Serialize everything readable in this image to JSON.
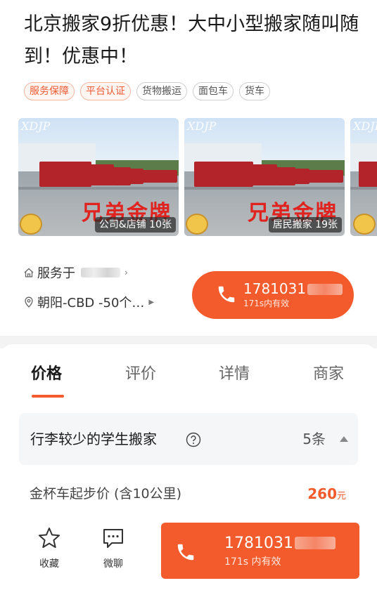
{
  "listing": {
    "title": "北京搬家9折优惠！大中小型搬家随叫随到！优惠中！"
  },
  "tags": [
    {
      "label": "服务保障",
      "highlight": true
    },
    {
      "label": "平台认证",
      "highlight": true
    },
    {
      "label": "货物搬运",
      "highlight": false
    },
    {
      "label": "面包车",
      "highlight": false
    },
    {
      "label": "货车",
      "highlight": false
    }
  ],
  "gallery": {
    "watermark": "XDJP",
    "slogan": "兄弟金牌",
    "photos": [
      {
        "caption": "公司&店铺 10张"
      },
      {
        "caption": "居民搬家 19张"
      }
    ]
  },
  "service": {
    "served_prefix": "服务于",
    "location": "朝阳-CBD -50个…"
  },
  "call_top": {
    "number": "1781031",
    "validity": "171s内有效"
  },
  "tabs": [
    {
      "label": "价格",
      "active": true
    },
    {
      "label": "评价",
      "active": false
    },
    {
      "label": "详情",
      "active": false
    },
    {
      "label": "商家",
      "active": false
    }
  ],
  "package": {
    "title": "行李较少的学生搬家",
    "count": "5条"
  },
  "price_item": {
    "label": "金杯车起步价 (含10公里)",
    "value": "260",
    "unit": "元"
  },
  "bottom_bar": {
    "favorite_label": "收藏",
    "chat_label": "微聊",
    "call_number": "1781031",
    "call_validity": "171s 内有效"
  },
  "colors": {
    "accent": "#f45b2c",
    "tag_highlight_text": "#ef5a34"
  }
}
